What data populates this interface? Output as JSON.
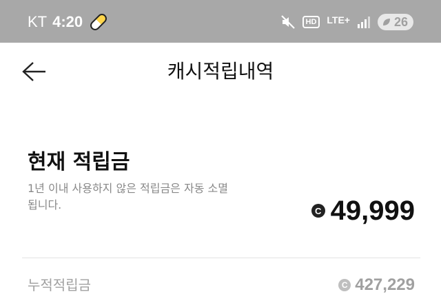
{
  "status_bar": {
    "carrier": "KT",
    "time": "4:20",
    "network": "LTE+",
    "hd_label": "HD",
    "battery": "26"
  },
  "header": {
    "title": "캐시적립내역"
  },
  "current": {
    "title": "현재 적립금",
    "description": "1년 이내 사용하지 않은 적립금은 자동 소멸됩니다.",
    "coin_symbol": "C",
    "value": "49,999"
  },
  "cumulative": {
    "label": "누적적립금",
    "coin_symbol": "C",
    "value": "427,229"
  },
  "colors": {
    "status_bar_bg": "#a8a8a8",
    "text_primary": "#111111",
    "text_secondary": "#888888",
    "text_muted": "#a0a0a0",
    "coin_dark": "#222222"
  },
  "icons": {
    "back": "back-arrow-icon",
    "pill": "pill-icon",
    "mute": "mute-icon",
    "signal": "signal-icon",
    "battery": "battery-leaf-icon"
  }
}
